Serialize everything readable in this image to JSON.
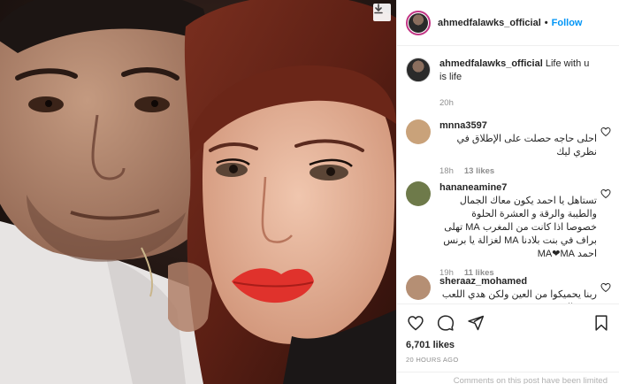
{
  "post": {
    "username": "ahmedfalawks_official",
    "follow_label": "Follow",
    "dot": "•",
    "caption_user": "ahmedfalawks_official",
    "caption_text": "Life with u is life",
    "caption_time": "20h",
    "likes": "6,701 likes",
    "posted": "20 HOURS AGO",
    "limited_notice": "Comments on this post have been limited"
  },
  "comments": [
    {
      "user": "mnna3597",
      "text": "احلى حاجه حصلت على الإطلاق في نظري ليك",
      "time": "18h",
      "likes": "13 likes",
      "avatar_color": "#c9a27a"
    },
    {
      "user": "hananeamine7",
      "text": "تستاهل يا احمد يكون معاك الجمال والطيبة والرقة و العشرة الحلوة خصوصا اذا كانت من المغرب MA تهلى براف في بنت بلادنا MA لغزالة يا برنس احمد MA❤MA",
      "time": "19h",
      "likes": "11 likes",
      "avatar_color": "#6e7a4a"
    },
    {
      "user": "sheraaz_mohamed",
      "text": "ربنا يحميكوا من العين ولكن هدي اللعب شويه الحسد",
      "time": "",
      "likes": "",
      "avatar_color": "#b58f74"
    }
  ],
  "icons": {
    "download": "download-icon",
    "like": "heart-icon",
    "comment": "comment-icon",
    "share": "share-icon",
    "save": "bookmark-icon"
  },
  "colors": {
    "follow": "#0095f6",
    "muted": "#8e8e8e",
    "lips": "#e0322c"
  }
}
